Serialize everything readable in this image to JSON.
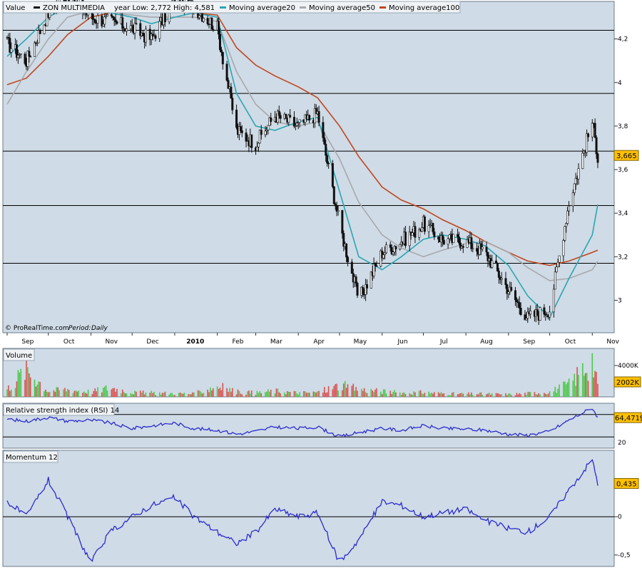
{
  "colors": {
    "plot_bg": "#cfdbe6",
    "frame_bg": "#e4eaf0",
    "price": "#111111",
    "ma20": "#2aa6b4",
    "ma50": "#a7a9ac",
    "ma100": "#c0461c",
    "volume_up": "#4cc94c",
    "volume_down": "#d9534f",
    "indicator_line": "#2b2bcf",
    "last_value_bg": "#ffc000"
  },
  "header": {
    "value_label": "Value",
    "instrument": "ZON MULTIMEDIA",
    "year_range": "year Low: 2,772 High: 4,581",
    "ma20_label": "Moving average20",
    "ma50_label": "Moving average50",
    "ma100_label": "Moving average100"
  },
  "footer_note": {
    "source": "© ProRealTime.com",
    "period_label": "Period:",
    "period_value": "Daily"
  },
  "price_panel": {
    "y_ticks": [
      {
        "v": 3.0,
        "label": "3"
      },
      {
        "v": 3.2,
        "label": "3,2"
      },
      {
        "v": 3.4,
        "label": "3,4"
      },
      {
        "v": 3.6,
        "label": "3,6"
      },
      {
        "v": 3.8,
        "label": "3,8"
      },
      {
        "v": 4.0,
        "label": "4"
      },
      {
        "v": 4.2,
        "label": "4,2"
      }
    ],
    "last_label": "3,665"
  },
  "volume_panel": {
    "title": "Volume",
    "tick_label": "4000K",
    "last_label": "2002K"
  },
  "rsi_panel": {
    "title": "Relative strength index (RSI) 14",
    "tick_label": "20",
    "last_label": "64,4719"
  },
  "momentum_panel": {
    "title": "Momentum 12",
    "y_ticks": [
      {
        "v": 0,
        "label": "0"
      },
      {
        "v": -0.5,
        "label": "-0,5"
      }
    ],
    "last_label": "0,435"
  },
  "x_axis": {
    "months": [
      "Sep",
      "Oct",
      "Nov",
      "Dec",
      "2010",
      "Feb",
      "Mar",
      "Apr",
      "May",
      "Jun",
      "Jul",
      "Aug",
      "Sep",
      "Oct",
      "Nov"
    ]
  },
  "chart_data": [
    {
      "type": "line",
      "name": "ZON MULTIMEDIA",
      "period": "Daily",
      "x": [
        "2009-09-01",
        "2009-09-15",
        "2009-10-01",
        "2009-10-15",
        "2009-11-01",
        "2009-11-15",
        "2009-12-01",
        "2009-12-15",
        "2010-01-01",
        "2010-01-15",
        "2010-02-01",
        "2010-02-15",
        "2010-03-01",
        "2010-03-15",
        "2010-04-01",
        "2010-04-15",
        "2010-05-01",
        "2010-05-15",
        "2010-06-01",
        "2010-06-15",
        "2010-07-01",
        "2010-07-15",
        "2010-08-01",
        "2010-08-15",
        "2010-09-01",
        "2010-09-15",
        "2010-10-01",
        "2010-10-15",
        "2010-11-01",
        "2010-11-05"
      ],
      "series": [
        {
          "name": "ZON MULTIMEDIA",
          "values": [
            4.18,
            4.1,
            4.32,
            4.4,
            4.3,
            4.28,
            4.25,
            4.2,
            4.38,
            4.35,
            4.25,
            3.78,
            3.72,
            3.85,
            3.8,
            3.86,
            3.35,
            3.0,
            3.22,
            3.27,
            3.35,
            3.28,
            3.27,
            3.22,
            3.05,
            2.92,
            2.96,
            3.45,
            3.82,
            3.665
          ]
        },
        {
          "name": "Moving average20",
          "values": [
            4.12,
            4.2,
            4.3,
            4.35,
            4.33,
            4.32,
            4.3,
            4.27,
            4.3,
            4.32,
            4.3,
            3.95,
            3.8,
            3.78,
            3.82,
            3.84,
            3.5,
            3.2,
            3.14,
            3.2,
            3.28,
            3.3,
            3.28,
            3.25,
            3.16,
            3.02,
            2.92,
            3.1,
            3.3,
            3.44
          ]
        },
        {
          "name": "Moving average50",
          "values": [
            3.9,
            4.05,
            4.2,
            4.3,
            4.33,
            4.32,
            4.31,
            4.3,
            4.3,
            4.3,
            4.28,
            4.05,
            3.9,
            3.82,
            3.8,
            3.82,
            3.65,
            3.45,
            3.3,
            3.24,
            3.2,
            3.23,
            3.26,
            3.27,
            3.22,
            3.15,
            3.09,
            3.1,
            3.14,
            3.18
          ]
        },
        {
          "name": "Moving average100",
          "values": [
            3.99,
            4.02,
            4.12,
            4.22,
            4.3,
            4.32,
            4.33,
            4.33,
            4.33,
            4.32,
            4.31,
            4.16,
            4.08,
            4.03,
            3.98,
            3.93,
            3.8,
            3.66,
            3.52,
            3.46,
            3.42,
            3.37,
            3.32,
            3.27,
            3.22,
            3.18,
            3.16,
            3.18,
            3.22,
            3.23
          ]
        }
      ],
      "ylim": [
        2.9,
        4.32
      ],
      "y_ticks": [
        3.0,
        3.2,
        3.4,
        3.6,
        3.8,
        4.0,
        4.2
      ],
      "reference_lines": [
        3.17,
        3.435,
        3.685,
        3.95,
        4.24
      ],
      "grid": false,
      "legend": "top",
      "year_low": 2.772,
      "year_high": 4.581,
      "last_value": 3.665
    },
    {
      "type": "bar",
      "name": "Volume",
      "x": [
        "2009-09-01",
        "2009-09-15",
        "2009-10-01",
        "2009-10-15",
        "2009-11-01",
        "2009-11-15",
        "2009-12-01",
        "2009-12-15",
        "2010-01-01",
        "2010-01-15",
        "2010-02-01",
        "2010-02-15",
        "2010-03-01",
        "2010-03-15",
        "2010-04-01",
        "2010-04-15",
        "2010-05-01",
        "2010-05-15",
        "2010-06-01",
        "2010-06-15",
        "2010-07-01",
        "2010-07-15",
        "2010-08-01",
        "2010-08-15",
        "2010-09-01",
        "2010-09-15",
        "2010-10-01",
        "2010-10-15",
        "2010-11-01",
        "2010-11-05"
      ],
      "values": [
        1500,
        5700,
        1200,
        1500,
        1000,
        1900,
        900,
        800,
        700,
        600,
        2200,
        1000,
        800,
        1200,
        800,
        900,
        2300,
        1500,
        1100,
        800,
        900,
        700,
        600,
        600,
        500,
        700,
        1000,
        2500,
        7600,
        2002
      ],
      "units": "K",
      "ylim": [
        0,
        8000
      ],
      "y_ticks": [
        4000
      ],
      "last_value": 2002
    },
    {
      "type": "line",
      "name": "Relative strength index (RSI) 14",
      "x": [
        "2009-09-01",
        "2009-09-15",
        "2009-10-01",
        "2009-10-15",
        "2009-11-01",
        "2009-11-15",
        "2009-12-01",
        "2009-12-15",
        "2010-01-01",
        "2010-01-15",
        "2010-02-01",
        "2010-02-15",
        "2010-03-01",
        "2010-03-15",
        "2010-04-01",
        "2010-04-15",
        "2010-05-01",
        "2010-05-15",
        "2010-06-01",
        "2010-06-15",
        "2010-07-01",
        "2010-07-15",
        "2010-08-01",
        "2010-08-15",
        "2010-09-01",
        "2010-09-15",
        "2010-10-01",
        "2010-10-15",
        "2010-11-01",
        "2010-11-05"
      ],
      "values": [
        62,
        58,
        65,
        58,
        60,
        55,
        45,
        50,
        55,
        45,
        42,
        35,
        40,
        48,
        45,
        48,
        30,
        38,
        45,
        42,
        50,
        45,
        44,
        42,
        35,
        33,
        40,
        60,
        82,
        64.4719
      ],
      "ylim": [
        10,
        90
      ],
      "y_ticks": [
        20
      ],
      "reference_lines": [
        30,
        70
      ],
      "last_value": 64.4719
    },
    {
      "type": "line",
      "name": "Momentum 12",
      "x": [
        "2009-09-01",
        "2009-09-15",
        "2009-10-01",
        "2009-10-15",
        "2009-11-01",
        "2009-11-15",
        "2009-12-01",
        "2009-12-15",
        "2010-01-01",
        "2010-01-15",
        "2010-02-01",
        "2010-02-15",
        "2010-03-01",
        "2010-03-15",
        "2010-04-01",
        "2010-04-15",
        "2010-05-01",
        "2010-05-15",
        "2010-06-01",
        "2010-06-15",
        "2010-07-01",
        "2010-07-15",
        "2010-08-01",
        "2010-08-15",
        "2010-09-01",
        "2010-09-15",
        "2010-10-01",
        "2010-10-15",
        "2010-11-01",
        "2010-11-05"
      ],
      "values": [
        0.2,
        0.0,
        0.48,
        0.0,
        -0.6,
        -0.2,
        0.0,
        0.15,
        0.25,
        0.0,
        -0.2,
        -0.35,
        -0.2,
        0.1,
        0.0,
        0.05,
        -0.6,
        -0.3,
        0.2,
        0.15,
        0.0,
        0.05,
        0.1,
        -0.05,
        -0.15,
        -0.2,
        0.0,
        0.35,
        0.75,
        0.435
      ],
      "ylim": [
        -0.65,
        0.85
      ],
      "y_ticks": [
        0,
        -0.5
      ],
      "last_value": 0.435
    }
  ]
}
